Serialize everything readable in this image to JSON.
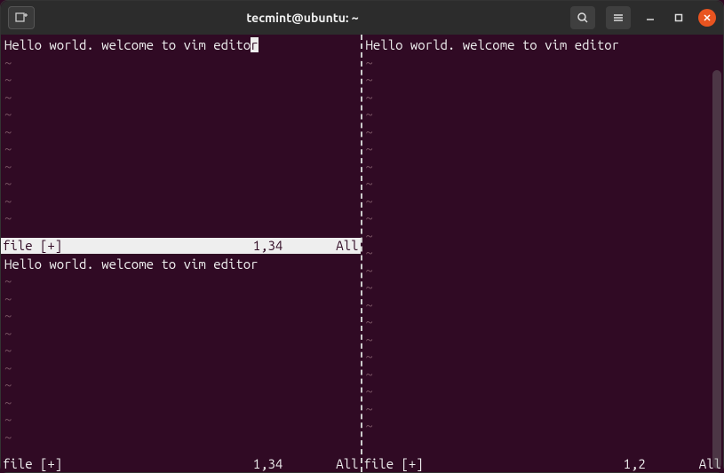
{
  "window": {
    "title": "tecmint@ubuntu: ~"
  },
  "panes": {
    "topLeft": {
      "text": "Hello world. welcome to vim edito",
      "lastChar": "r",
      "status": {
        "filename": "file [+]",
        "pos": "1,34",
        "pct": "All"
      },
      "active": true
    },
    "bottomLeft": {
      "text": "Hello world. welcome to vim editor",
      "status": {
        "filename": "file [+]",
        "pos": "1,34",
        "pct": "All"
      },
      "active": false
    },
    "right": {
      "text": "Hello world. welcome to vim editor",
      "status": {
        "filename": "file [+]",
        "pos": "1,2",
        "pct": "All"
      },
      "active": false
    }
  },
  "tilde": "~"
}
